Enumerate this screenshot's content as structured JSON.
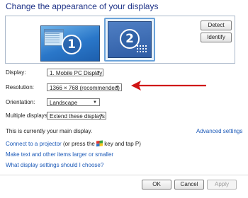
{
  "header": {
    "title": "Change the appearance of your displays"
  },
  "preview": {
    "monitor1_number": "1",
    "monitor2_number": "2",
    "detect_label": "Detect",
    "identify_label": "Identify"
  },
  "settings": {
    "display_label": "Display:",
    "display_value": "1. Mobile PC Display",
    "resolution_label": "Resolution:",
    "resolution_value": "1366 × 768 (recommended)",
    "orientation_label": "Orientation:",
    "orientation_value": "Landscape",
    "multiple_label": "Multiple displays:",
    "multiple_value": "Extend these displays",
    "main_display_text": "This is currently your main display.",
    "advanced_link": "Advanced settings"
  },
  "links": {
    "projector_link": "Connect to a projector",
    "projector_tail_1": " (or press the ",
    "projector_tail_2": " key and tap P)",
    "text_size_link": "Make text and other items larger or smaller",
    "which_settings_link": "What display settings should I choose?"
  },
  "footer": {
    "ok_label": "OK",
    "cancel_label": "Cancel",
    "apply_label": "Apply"
  },
  "colors": {
    "title": "#1e3287",
    "link": "#1a58b7",
    "annotation_arrow": "#d01515",
    "monitor_selected": "#2a77c9"
  },
  "icons": {
    "arrow": "red-pointer-arrow",
    "windows_key": "windows-logo-icon",
    "dropdown": "chevron-down-icon"
  }
}
